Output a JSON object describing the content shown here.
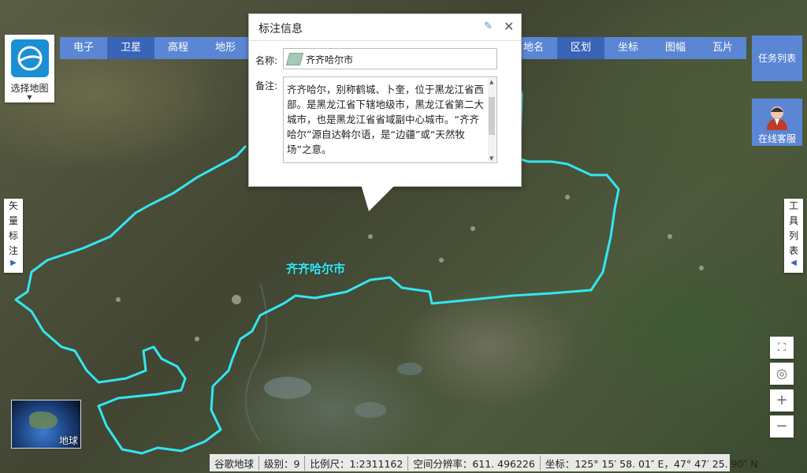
{
  "map_type_selector": {
    "label": "选择地图"
  },
  "map_tabs": [
    "电子",
    "卫星",
    "高程",
    "地形"
  ],
  "map_tabs_active": 1,
  "tool_tabs": [
    "地名",
    "区划",
    "坐标",
    "图幅",
    "瓦片"
  ],
  "tool_tabs_active": 1,
  "right_buttons": {
    "task_list": "任务列表",
    "online_service": "在线客服"
  },
  "left_panel_tab": [
    "矢",
    "量",
    "标",
    "注"
  ],
  "right_panel_tab": [
    "工",
    "具",
    "列",
    "表"
  ],
  "popup": {
    "title": "标注信息",
    "name_label": "名称:",
    "name_value": "齐齐哈尔市",
    "note_label": "备注:",
    "note_value": "齐齐哈尔，别称鹤城、卜奎，位于黑龙江省西部。是黑龙江省下辖地级市，黑龙江省第二大城市，也是黑龙江省省域副中心城市。“齐齐哈尔”源自达斡尔语，是“边疆”或“天然牧场”之意。"
  },
  "map_label": "齐齐哈尔市",
  "globe_thumbnail_label": "地球",
  "status_bar": {
    "source": "谷歌地球",
    "level": "级别：9",
    "scale": "比例尺：1:2311162",
    "resolution": "空间分辨率：611. 496226",
    "coordinate": "坐标：125° 15′ 58. 01″ E，47° 47′ 25. 90″ N"
  },
  "colors": {
    "boundary": "#33e6f2",
    "toolbar": "#5b86d4",
    "toolbar_active": "#3a64b8"
  },
  "icons": [
    "pencil-icon",
    "close-icon",
    "fullscreen-icon",
    "locate-icon",
    "zoom-in-icon",
    "zoom-out-icon",
    "globe-icon",
    "customer-service-icon"
  ]
}
